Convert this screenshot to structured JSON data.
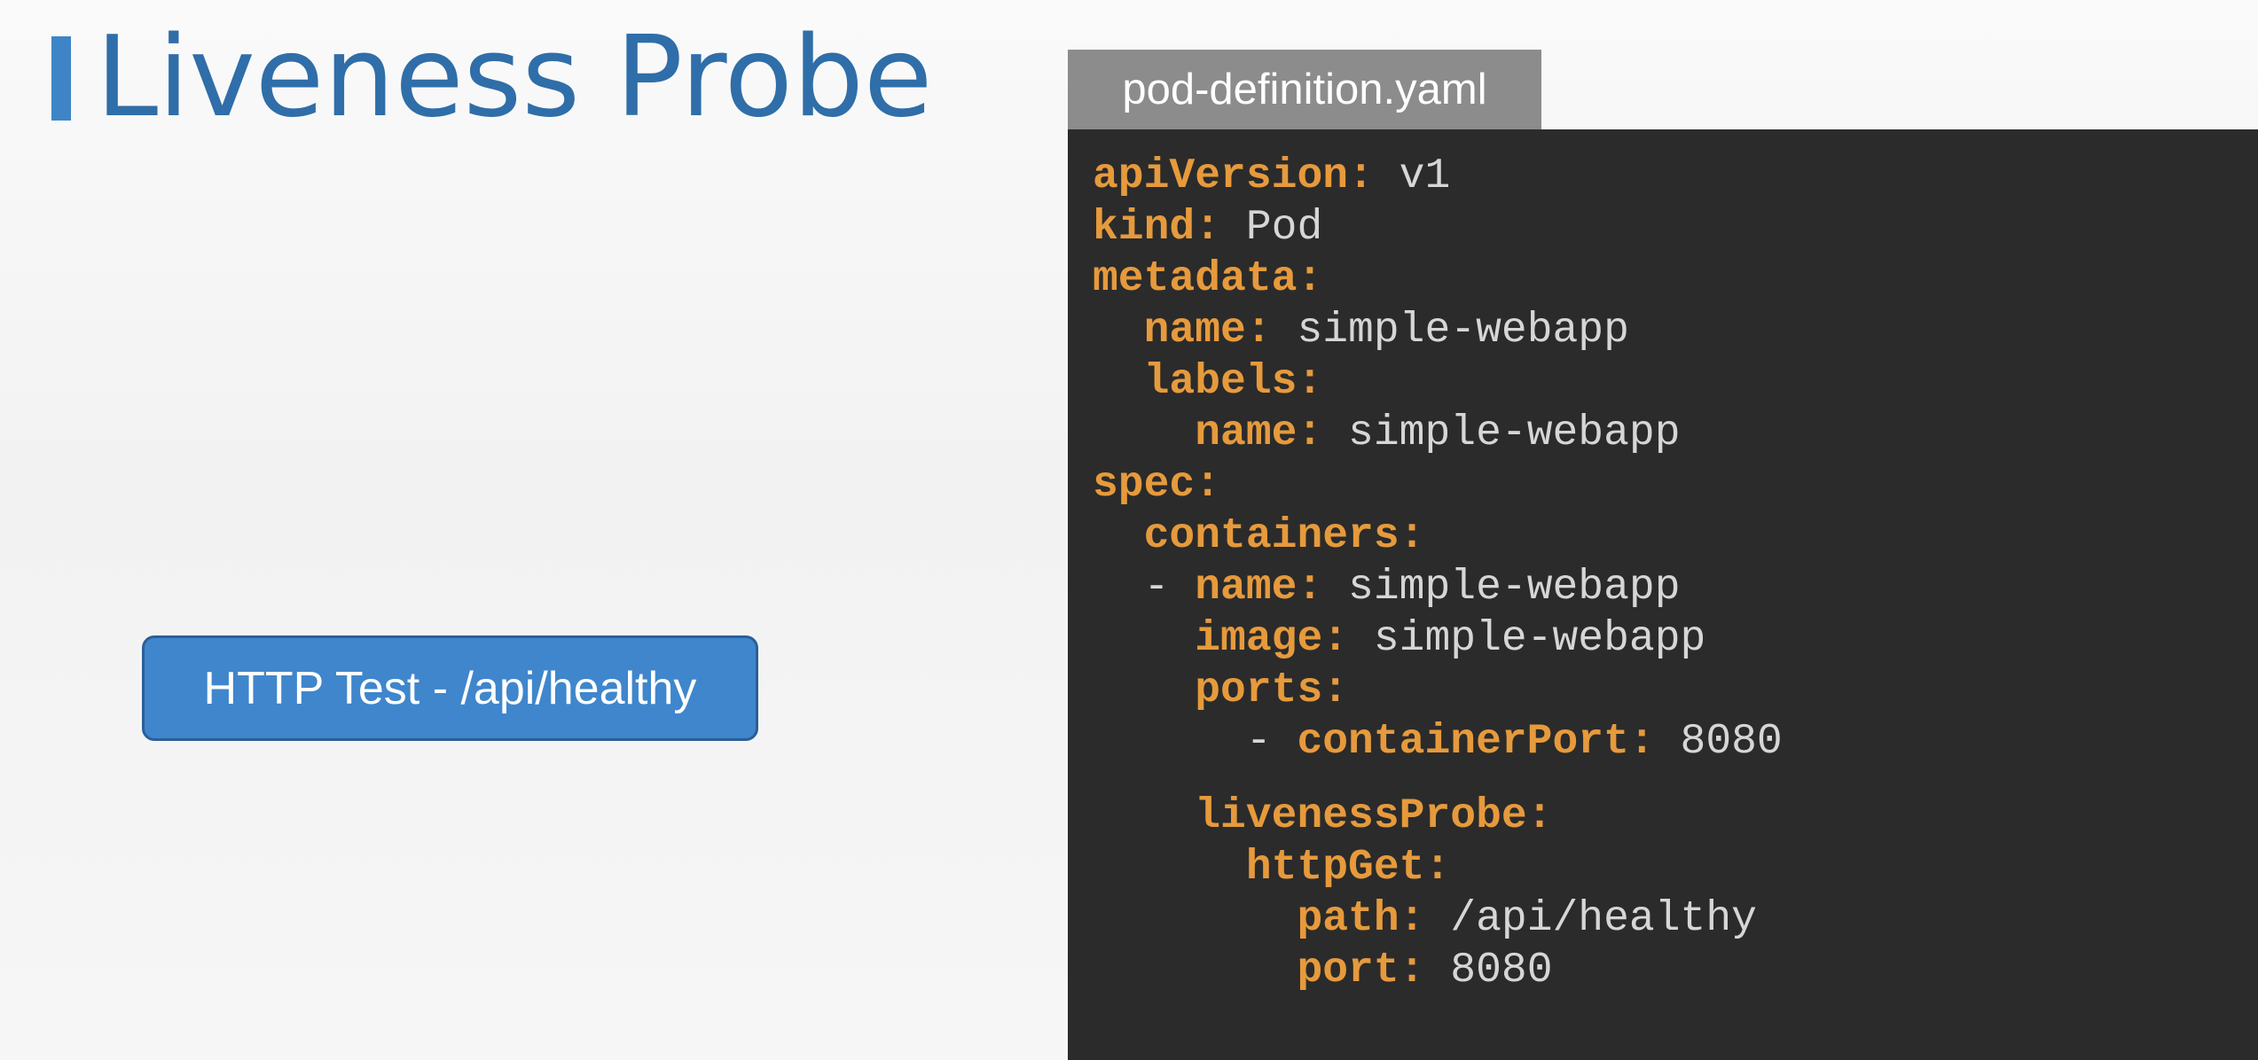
{
  "slide": {
    "title": "Liveness Probe",
    "accent_color": "#3d85c6",
    "title_color": "#2f6ea8"
  },
  "test_box": {
    "label": "HTTP Test - /api/healthy",
    "background_color": "#3f86cc"
  },
  "file_tab": {
    "label": "pod-definition.yaml"
  },
  "code": {
    "key_color": "#e69a3c",
    "value_color": "#d6d6d6",
    "background_color": "#2b2b2b",
    "lines": [
      {
        "indent": "",
        "dash": "",
        "key": "apiVersion:",
        "value": " v1"
      },
      {
        "indent": "",
        "dash": "",
        "key": "kind:",
        "value": " Pod"
      },
      {
        "indent": "",
        "dash": "",
        "key": "metadata:",
        "value": ""
      },
      {
        "indent": "  ",
        "dash": "",
        "key": "name:",
        "value": " simple-webapp"
      },
      {
        "indent": "  ",
        "dash": "",
        "key": "labels:",
        "value": ""
      },
      {
        "indent": "    ",
        "dash": "",
        "key": "name:",
        "value": " simple-webapp"
      },
      {
        "indent": "",
        "dash": "",
        "key": "spec:",
        "value": ""
      },
      {
        "indent": "  ",
        "dash": "",
        "key": "containers:",
        "value": ""
      },
      {
        "indent": "  ",
        "dash": "- ",
        "key": "name:",
        "value": " simple-webapp"
      },
      {
        "indent": "    ",
        "dash": "",
        "key": "image:",
        "value": " simple-webapp"
      },
      {
        "indent": "    ",
        "dash": "",
        "key": "ports:",
        "value": ""
      },
      {
        "indent": "      ",
        "dash": "- ",
        "key": "containerPort:",
        "value": " 8080"
      },
      {
        "indent": "    ",
        "dash": "",
        "key": "livenessProbe:",
        "value": ""
      },
      {
        "indent": "      ",
        "dash": "",
        "key": "httpGet:",
        "value": ""
      },
      {
        "indent": "        ",
        "dash": "",
        "key": "path:",
        "value": " /api/healthy"
      },
      {
        "indent": "        ",
        "dash": "",
        "key": "port:",
        "value": " 8080"
      }
    ]
  }
}
